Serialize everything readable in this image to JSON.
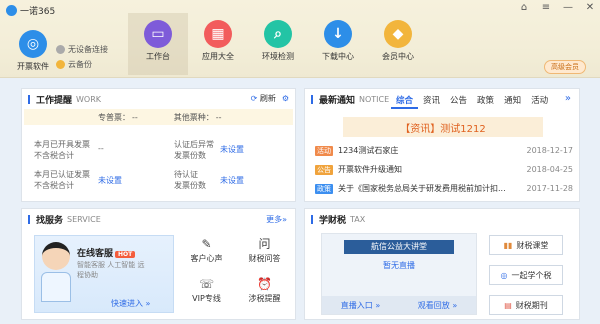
{
  "titlebar": {
    "app_title": "一诺365"
  },
  "leftnav": {
    "label": "开票软件"
  },
  "status": {
    "device": "无设备连接",
    "cloud": "云备份"
  },
  "nav": [
    {
      "label": "工作台",
      "glyph": "▭",
      "color": "#7e5bd9"
    },
    {
      "label": "应用大全",
      "glyph": "▦",
      "color": "#f25c5c"
    },
    {
      "label": "环境检测",
      "glyph": "⌕",
      "color": "#23c4a5"
    },
    {
      "label": "下载中心",
      "glyph": "↓",
      "color": "#2d8ee8"
    },
    {
      "label": "会员中心",
      "glyph": "◆",
      "color": "#f2b53c"
    }
  ],
  "member_badge": "高级会员",
  "work": {
    "title": "工作提醒",
    "title_en": "WORK",
    "refresh": "刷新",
    "col1": "专普票：",
    "col1_val": "--",
    "col2": "其他票种：",
    "col2_val": "--",
    "items": [
      {
        "l1": "本月已开具发票",
        "l2": "不含税合计",
        "val": "--"
      },
      {
        "l1": "认证后异常",
        "l2": "发票份数",
        "val": "未设置"
      },
      {
        "l1": "本月已认证发票",
        "l2": "不含税合计",
        "val": "未设置"
      },
      {
        "l1": "待认证",
        "l2": "发票份数",
        "val": "未设置"
      }
    ]
  },
  "notice": {
    "title": "最新通知",
    "title_en": "NOTICE",
    "tabs": [
      "综合",
      "资讯",
      "公告",
      "政策",
      "通知",
      "活动"
    ],
    "more": "»",
    "banner": "【资讯】测试1212",
    "rows": [
      {
        "tag": "活动",
        "tag_color": "#f08a4b",
        "text": "1234测试石家庄",
        "date": "2018-12-17"
      },
      {
        "tag": "公告",
        "tag_color": "#f0a33c",
        "text": "开票软件升级通知",
        "date": "2018-04-25"
      },
      {
        "tag": "政策",
        "tag_color": "#3c8ff0",
        "text": "关于《国家税务总局关于研发费用税前加计扣...",
        "date": "2017-11-28"
      }
    ]
  },
  "service": {
    "title": "找服务",
    "title_en": "SERVICE",
    "more": "更多»",
    "card_title": "在线客服",
    "hot": "HOT",
    "card_desc1": "智能客服 人工智能 远",
    "card_desc2": "程协助",
    "enter": "快速进入 »",
    "items": [
      {
        "label": "客户心声",
        "glyph": "✎"
      },
      {
        "label": "财税问答",
        "glyph": "问"
      },
      {
        "label": "VIP专线",
        "glyph": "☏"
      },
      {
        "label": "涉税提醒",
        "glyph": "⏰"
      }
    ]
  },
  "tax": {
    "title": "学财税",
    "title_en": "TAX",
    "video_title": "航信公益大讲堂",
    "no_live": "暂无直播",
    "live_entry": "直播入口 »",
    "replay": "观看回放 »",
    "buttons": [
      {
        "label": "财税课堂",
        "glyph": "▮▮"
      },
      {
        "label": "一起学个税",
        "glyph": "◎"
      },
      {
        "label": "财税期刊",
        "glyph": "▤"
      }
    ]
  }
}
